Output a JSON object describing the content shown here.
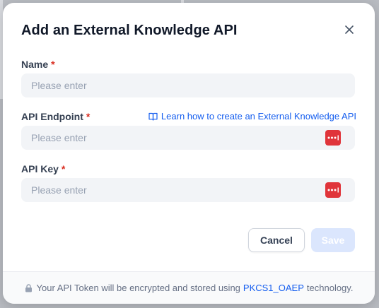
{
  "dialog": {
    "title": "Add an External Knowledge API"
  },
  "fields": {
    "name": {
      "label": "Name",
      "required_mark": "*",
      "placeholder": "Please enter"
    },
    "endpoint": {
      "label": "API Endpoint",
      "required_mark": "*",
      "placeholder": "Please enter",
      "help_link": "Learn how to create an External Knowledge API"
    },
    "api_key": {
      "label": "API Key",
      "required_mark": "*",
      "placeholder": "Please enter"
    }
  },
  "buttons": {
    "cancel": "Cancel",
    "save": "Save"
  },
  "footer": {
    "prefix": "Your API Token will be encrypted and stored using",
    "tech": "PKCS1_OAEP",
    "suffix": "technology."
  },
  "icons": {
    "close": "close-icon",
    "book": "book-icon",
    "password_manager": "password-manager-icon",
    "lock": "lock-icon"
  },
  "colors": {
    "accent": "#155eef",
    "required": "#d92d20",
    "password_manager": "#e0343a"
  }
}
